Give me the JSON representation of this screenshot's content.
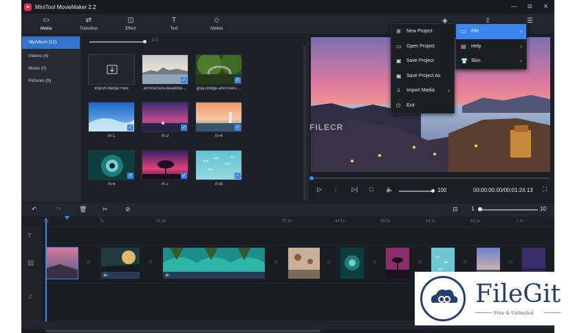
{
  "window": {
    "title": "MiniTool MovieMaker 2.2",
    "controls": [
      "—",
      "⧉",
      "✕"
    ]
  },
  "toolbar": {
    "items": [
      {
        "label": "Media",
        "icon": "folder-icon",
        "glyph": "▭"
      },
      {
        "label": "Transition",
        "icon": "transition-icon",
        "glyph": "⇄"
      },
      {
        "label": "Effect",
        "icon": "effect-icon",
        "glyph": "◫"
      },
      {
        "label": "Text",
        "icon": "text-icon",
        "glyph": "T"
      },
      {
        "label": "Motion",
        "icon": "motion-icon",
        "glyph": "◇"
      }
    ],
    "right_icons": [
      "layers-icon",
      "export-icon",
      "menu-icon"
    ]
  },
  "library": {
    "categories": [
      {
        "label": "MyAlbum  (12)",
        "active": true
      },
      {
        "label": "Videos  (4)",
        "active": false
      },
      {
        "label": "Music  (0)",
        "active": false
      },
      {
        "label": "Pictures  (8)",
        "active": false
      }
    ],
    "zoom_value": "100",
    "media": [
      {
        "name": "Import Media Files",
        "type": "import"
      },
      {
        "name": "architecture-beautiful-...",
        "type": "lake-dusk",
        "checked": true
      },
      {
        "name": "gray-bridge-and-trees-...",
        "type": "bridge",
        "checked": true
      },
      {
        "name": "m-1",
        "type": "sky",
        "checked": true
      },
      {
        "name": "m-3",
        "type": "purple-dusk",
        "checked": true
      },
      {
        "name": "m-4",
        "type": "lighthouse",
        "checked": true
      },
      {
        "name": "m-5",
        "type": "eye",
        "checked": true
      },
      {
        "name": "m-7",
        "type": "tree",
        "checked": true
      },
      {
        "name": "m-8",
        "type": "birds",
        "checked": true
      }
    ]
  },
  "preview": {
    "watermark": "FILECR",
    "volume": "100",
    "time": "00:00:00.00/00:01:24.13"
  },
  "timeline": {
    "zoom_min": "1",
    "zoom_max": "10",
    "ruler": [
      "0s",
      "7s",
      "15.4s",
      "37.9s",
      "44.5s",
      "49.5s",
      "54.5s",
      "59.3s",
      "1 m"
    ]
  },
  "main_menu": {
    "items": [
      {
        "label": "New Project",
        "icon": "new-project-icon",
        "glyph": "⊞"
      },
      {
        "label": "Open Project",
        "icon": "open-project-icon",
        "glyph": "▭"
      },
      {
        "label": "Save Project",
        "icon": "save-project-icon",
        "glyph": "▣"
      },
      {
        "label": "Save Project As",
        "icon": "save-as-icon",
        "glyph": "▣"
      },
      {
        "label": "Import Media",
        "icon": "import-media-icon",
        "glyph": "⇩"
      },
      {
        "label": "Exit",
        "icon": "exit-icon",
        "glyph": "⏻"
      }
    ]
  },
  "top_menu": {
    "items": [
      {
        "label": "File",
        "icon": "file-icon",
        "glyph": "▭",
        "highlighted": true
      },
      {
        "label": "Help",
        "icon": "help-icon",
        "glyph": "▤",
        "highlighted": false
      },
      {
        "label": "Skin",
        "icon": "skin-icon",
        "glyph": "👕",
        "highlighted": false
      }
    ]
  },
  "watermark_filegit": {
    "name": "FileGit",
    "tagline": "Free & Unlimited"
  },
  "colors": {
    "accent": "#3b86f0",
    "bg": "#22262d",
    "selected_album": "#3474cf"
  }
}
